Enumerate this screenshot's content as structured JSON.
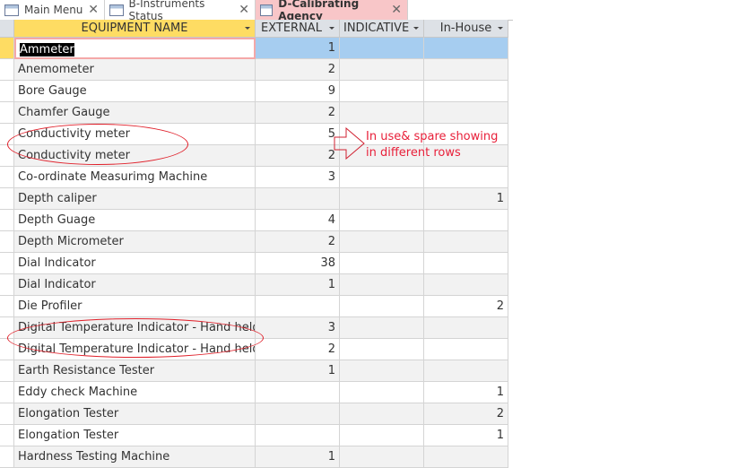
{
  "tabs": [
    {
      "label": "Main Menu"
    },
    {
      "label": "B-Instruments Status"
    },
    {
      "label": "D-Calibrating Agency"
    }
  ],
  "columns": [
    "EQUIPMENT NAME",
    "EXTERNAL",
    "INDICATIVE",
    "In-House"
  ],
  "rows": [
    [
      "Ammeter",
      "1",
      "",
      ""
    ],
    [
      "Anemometer",
      "2",
      "",
      ""
    ],
    [
      "Bore Gauge",
      "9",
      "",
      ""
    ],
    [
      "Chamfer Gauge",
      "2",
      "",
      ""
    ],
    [
      "Conductivity meter",
      "5",
      "",
      ""
    ],
    [
      "Conductivity meter",
      "2",
      "",
      ""
    ],
    [
      "Co-ordinate Measurimg Machine",
      "3",
      "",
      ""
    ],
    [
      "Depth caliper",
      "",
      "",
      "1"
    ],
    [
      "Depth Guage",
      "4",
      "",
      ""
    ],
    [
      "Depth Micrometer",
      "2",
      "",
      ""
    ],
    [
      "Dial Indicator",
      "38",
      "",
      ""
    ],
    [
      "Dial Indicator",
      "1",
      "",
      ""
    ],
    [
      "Die Profiler",
      "",
      "",
      "2"
    ],
    [
      "Digital Temperature Indicator - Hand held",
      "3",
      "",
      ""
    ],
    [
      "Digital Temperature Indicator - Hand held",
      "2",
      "",
      ""
    ],
    [
      "Earth Resistance Tester",
      "1",
      "",
      ""
    ],
    [
      "Eddy check Machine",
      "",
      "",
      "1"
    ],
    [
      "Elongation Tester",
      "",
      "",
      "2"
    ],
    [
      "Elongation Tester",
      "",
      "",
      "1"
    ],
    [
      "Hardness Testing Machine",
      "1",
      "",
      ""
    ]
  ],
  "annotation": {
    "line1": "In use& spare showing",
    "line2": "in different rows"
  }
}
